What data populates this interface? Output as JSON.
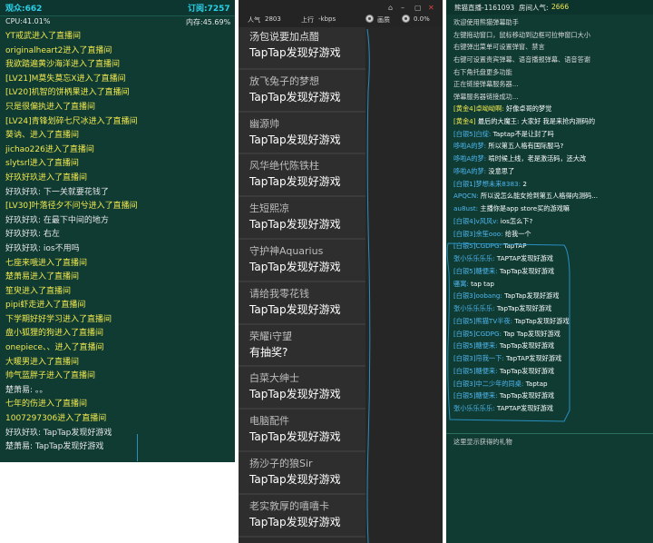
{
  "left": {
    "viewers_label": "观众:662",
    "subs_label": "订阅:7257",
    "cpu_label": "CPU:41.01%",
    "mem_label": "内存:45.69%",
    "lines": [
      {
        "text": "YT戒武进入了直播间",
        "color": "yellow"
      },
      {
        "text": "originalheart2进入了直播间",
        "color": "yellow"
      },
      {
        "text": "我欲踏遍黄沙海洋进入了直播间",
        "color": "yellow"
      },
      {
        "text": "[LV21]M莫失莫忘X进入了直播间",
        "color": "yellow"
      },
      {
        "text": "[LV20]机智的饼柄果进入了直播间",
        "color": "yellow"
      },
      {
        "text": "只是很偏执进入了直播间",
        "color": "yellow"
      },
      {
        "text": "[LV24]青锋划碎七尺冰进入了直播间",
        "color": "yellow"
      },
      {
        "text": "葵讷、进入了直播间",
        "color": "yellow"
      },
      {
        "text": "jichao226进入了直播间",
        "color": "yellow"
      },
      {
        "text": "slytsrl进入了直播间",
        "color": "yellow"
      },
      {
        "text": "好玖好玖进入了直播间",
        "color": "yellow"
      },
      {
        "text": "好玖好玖: 下一关就要花钱了",
        "color": "white"
      },
      {
        "text": "[LV30]叶落径夕不问兮进入了直播间",
        "color": "yellow"
      },
      {
        "text": "好玖好玖: 在最下中间的地方",
        "color": "white"
      },
      {
        "text": "好玖好玖: 右左",
        "color": "white"
      },
      {
        "text": "好玖好玖: ios不用吗",
        "color": "white"
      },
      {
        "text": "七座来哦进入了直播间",
        "color": "yellow"
      },
      {
        "text": "楚萧易进入了直播间",
        "color": "yellow"
      },
      {
        "text": "笙臾进入了直播间",
        "color": "yellow"
      },
      {
        "text": "pipi虾走进入了直播间",
        "color": "yellow"
      },
      {
        "text": "下学期好好学习进入了直播间",
        "color": "yellow"
      },
      {
        "text": "盘小狐狸的狗进入了直播间",
        "color": "yellow"
      },
      {
        "text": "onepiece、、进入了直播间",
        "color": "yellow"
      },
      {
        "text": "大暖男进入了直播间",
        "color": "yellow"
      },
      {
        "text": "帅气蓝胖子进入了直播间",
        "color": "yellow"
      },
      {
        "text": "楚萧易: 。。",
        "color": "white"
      },
      {
        "text": "七年的伤进入了直播间",
        "color": "yellow"
      },
      {
        "text": "1007297306进入了直播间",
        "color": "yellow"
      },
      {
        "text": "好玖好玖: TapTap发现好游戏",
        "color": "white"
      },
      {
        "text": "楚萧易: TapTap发现好游戏",
        "color": "white"
      }
    ]
  },
  "middle": {
    "popularity_label": "人气",
    "popularity_value": "2803",
    "upload_label": "上行",
    "upload_value": "-kbps",
    "quality_label": "画质",
    "loss_value": "0.0%",
    "cards": [
      {
        "name": "汤包说要加点醋",
        "text": "TapTap发现好游戏"
      },
      {
        "name": "放飞兔子的梦想",
        "text": "TapTap发现好游戏"
      },
      {
        "name": "幽源帅",
        "text": "TapTap发现好游戏"
      },
      {
        "name": "风华绝代陈铁柱",
        "text": "TapTap发现好游戏"
      },
      {
        "name": "生短熙凉",
        "text": "TapTap发现好游戏"
      },
      {
        "name": "守护神Aquarius",
        "text": "TapTap发现好游戏"
      },
      {
        "name": "请给我零花钱",
        "text": "TapTap发现好游戏"
      },
      {
        "name": "荣耀i守望",
        "text": "有抽奖?"
      },
      {
        "name": "白菜大绅士",
        "text": "TapTap发现好游戏"
      },
      {
        "name": "电脑配件",
        "text": "TapTap发现好游戏"
      },
      {
        "name": "扬沙子的狼Sir",
        "text": "TapTap发现好游戏"
      },
      {
        "name": "老实敦厚的嘻嘻卡",
        "text": "TapTap发现好游戏"
      }
    ]
  },
  "right": {
    "title": "熊猫直播-1161093",
    "room_pop_label": "房间人气:",
    "room_pop_value": "2666",
    "system": [
      "欢迎使用熊猫弹幕助手",
      "左键拖动窗口，鼠标移动到边框可拉伸窗口大小",
      "右键弹出菜单可设置弹窗、禁言",
      "右键可设置贵宾弹幕、语音播报弹幕、语音答谢",
      "右下角托盘更多功能",
      "正在链接弹幕服务器...",
      "弹幕服务器链接成功..."
    ],
    "messages": [
      {
        "user": "[黄金4]卓呦呦啊:",
        "text": "好像卓哥的梦觉",
        "ucolor": "yellow"
      },
      {
        "user": "[黄金4]",
        "text": "最后的大魔王: 大家好 我是来抢内测码的",
        "ucolor": "yellow"
      },
      {
        "user": "[白银5]白绽:",
        "text": "Taptap不是让封了吗",
        "ucolor": "blue"
      },
      {
        "user": "哆啦A的梦:",
        "text": "所以第五人格有国际服马?",
        "ucolor": "blue"
      },
      {
        "user": "哆啦A的梦:",
        "text": "啃时候上线，老是激活码，还大改",
        "ucolor": "blue"
      },
      {
        "user": "哆啦A的梦:",
        "text": "没意思了",
        "ucolor": "blue"
      },
      {
        "user": "[白银1]梦想未来8383:",
        "text": "2",
        "ucolor": "blue"
      },
      {
        "user": "APQCN:",
        "text": "所以说怎么能女抢到第五人格得内测码...",
        "ucolor": "blue"
      },
      {
        "user": "au8ust:",
        "text": "主播你是app store买的游戏嘛",
        "ucolor": "blue"
      },
      {
        "user": "[白银4]v风风v:",
        "text": "ios怎么下?",
        "ucolor": "blue"
      },
      {
        "user": "[白银3]余笙ooo:",
        "text": "给我一个",
        "ucolor": "blue"
      },
      {
        "user": "[白银5]CGDPG:",
        "text": "TapTAP",
        "ucolor": "blue"
      },
      {
        "user": "张小乐乐乐乐:",
        "text": "TAPTAP发现好游戏",
        "ucolor": "blue"
      },
      {
        "user": "[白银5]糖便来:",
        "text": "TapTap发现好游戏",
        "ucolor": "blue"
      },
      {
        "user": "骚寓:",
        "text": "tap tap",
        "ucolor": "blue"
      },
      {
        "user": "[白银3]oobang:",
        "text": "TapTap发现好游戏",
        "ucolor": "blue"
      },
      {
        "user": "张小乐乐乐乐:",
        "text": "TapTap发现好游戏",
        "ucolor": "blue"
      },
      {
        "user": "[白银5]熊猫TV半夜:",
        "text": "TapTap发现好游戏",
        "ucolor": "blue"
      },
      {
        "user": "[白银5]CGDPG:",
        "text": "Tap Tap发现好游戏",
        "ucolor": "blue"
      },
      {
        "user": "[白银5]糖便来:",
        "text": "TapTap发现好游戏",
        "ucolor": "blue"
      },
      {
        "user": "[白银3]帘我一下:",
        "text": "TapTAP发现好游戏",
        "ucolor": "blue"
      },
      {
        "user": "[白银5]糖便来:",
        "text": "TapTap发现好游戏",
        "ucolor": "blue"
      },
      {
        "user": "[白银3]中二少年的同桌:",
        "text": "Taptap",
        "ucolor": "blue"
      },
      {
        "user": "[白银5]糖便来:",
        "text": "TapTap发现好游戏",
        "ucolor": "blue"
      },
      {
        "user": "张小乐乐乐乐:",
        "text": "TAPTAP发现好游戏",
        "ucolor": "blue"
      }
    ],
    "gift_placeholder": "这里显示获得的礼物"
  },
  "colors": {
    "panel_bg": "#0f3b33",
    "middle_bg": "#2b2b2b",
    "yellow_text": "#f2e94e",
    "blue_user": "#4fb7f0",
    "annotation_line": "#2a8fc0"
  }
}
